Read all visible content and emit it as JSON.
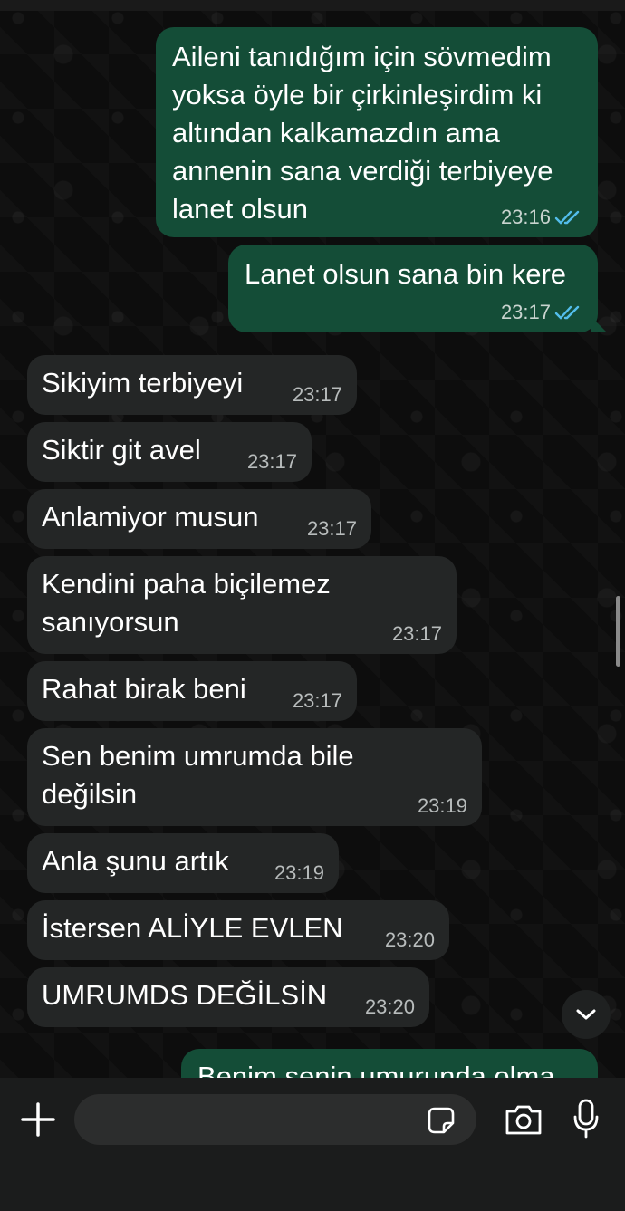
{
  "colors": {
    "outgoing_bubble": "#144d37",
    "incoming_bubble": "#242626",
    "read_ticks": "#53bdeb",
    "background": "#0d0d0d"
  },
  "messages": [
    {
      "dir": "out",
      "text": "Aileni tanıdığım için sövmedim\nyoksa öyle bir çirkinleşirdim ki\naltından kalkamazdın ama\nannenin sana verdiği terbiyeye\nlanet olsun",
      "time": "23:16",
      "read": true
    },
    {
      "dir": "out",
      "text": "Lanet olsun sana bin kere",
      "time": "23:17",
      "read": true
    },
    {
      "dir": "in",
      "text": "Sikiyim terbiyeyi",
      "time": "23:17"
    },
    {
      "dir": "in",
      "text": "Siktir git avel",
      "time": "23:17"
    },
    {
      "dir": "in",
      "text": "Anlamiyor musun",
      "time": "23:17"
    },
    {
      "dir": "in",
      "text": "Kendini paha biçilemez\nsanıyorsun",
      "time": "23:17"
    },
    {
      "dir": "in",
      "text": "Rahat birak beni",
      "time": "23:17"
    },
    {
      "dir": "in",
      "text": "Sen benim umrumda bile\ndeğilsin",
      "time": "23:19"
    },
    {
      "dir": "in",
      "text": "Anla şunu artık",
      "time": "23:19"
    },
    {
      "dir": "in",
      "text": "İstersen ALİYLE EVLEN",
      "time": "23:20"
    },
    {
      "dir": "in",
      "text": "UMRUMDS DEĞİLSİN",
      "time": "23:20"
    },
    {
      "dir": "out",
      "text": "Benim senin umurunda olma",
      "time": ""
    }
  ],
  "composer": {
    "plus_icon": "plus-icon",
    "sticker_icon": "sticker-icon",
    "camera_icon": "camera-icon",
    "mic_icon": "microphone-icon",
    "input_value": "",
    "input_placeholder": ""
  },
  "scroll_down_icon": "chevron-down-icon"
}
